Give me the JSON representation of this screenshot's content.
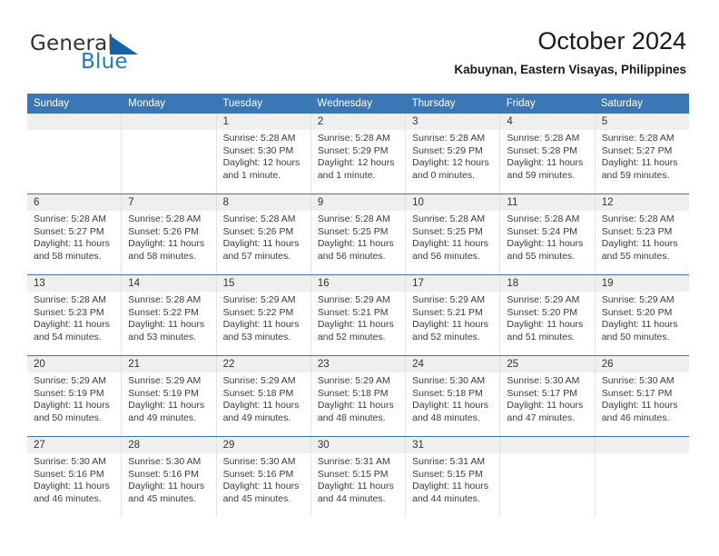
{
  "brand": {
    "name_part1": "General",
    "name_part2": "Blue",
    "mark_icon": "triangle-logo-icon"
  },
  "header": {
    "title": "October 2024",
    "subtitle": "Kabuynan, Eastern Visayas, Philippines"
  },
  "colors": {
    "header_blue": "#3a77b4",
    "brand_blue": "#1a7bc4",
    "date_band": "#efefef",
    "cell_border": "#e3e3e3",
    "text": "#3b3b3b"
  },
  "weekdays": [
    "Sunday",
    "Monday",
    "Tuesday",
    "Wednesday",
    "Thursday",
    "Friday",
    "Saturday"
  ],
  "weeks": [
    {
      "days": [
        {
          "num": "",
          "empty": true,
          "sunrise": "",
          "sunset": "",
          "daylight": ""
        },
        {
          "num": "",
          "empty": true,
          "sunrise": "",
          "sunset": "",
          "daylight": ""
        },
        {
          "num": "1",
          "sunrise": "Sunrise: 5:28 AM",
          "sunset": "Sunset: 5:30 PM",
          "daylight": "Daylight: 12 hours and 1 minute."
        },
        {
          "num": "2",
          "sunrise": "Sunrise: 5:28 AM",
          "sunset": "Sunset: 5:29 PM",
          "daylight": "Daylight: 12 hours and 1 minute."
        },
        {
          "num": "3",
          "sunrise": "Sunrise: 5:28 AM",
          "sunset": "Sunset: 5:29 PM",
          "daylight": "Daylight: 12 hours and 0 minutes."
        },
        {
          "num": "4",
          "sunrise": "Sunrise: 5:28 AM",
          "sunset": "Sunset: 5:28 PM",
          "daylight": "Daylight: 11 hours and 59 minutes."
        },
        {
          "num": "5",
          "sunrise": "Sunrise: 5:28 AM",
          "sunset": "Sunset: 5:27 PM",
          "daylight": "Daylight: 11 hours and 59 minutes."
        }
      ]
    },
    {
      "days": [
        {
          "num": "6",
          "sunrise": "Sunrise: 5:28 AM",
          "sunset": "Sunset: 5:27 PM",
          "daylight": "Daylight: 11 hours and 58 minutes."
        },
        {
          "num": "7",
          "sunrise": "Sunrise: 5:28 AM",
          "sunset": "Sunset: 5:26 PM",
          "daylight": "Daylight: 11 hours and 58 minutes."
        },
        {
          "num": "8",
          "sunrise": "Sunrise: 5:28 AM",
          "sunset": "Sunset: 5:26 PM",
          "daylight": "Daylight: 11 hours and 57 minutes."
        },
        {
          "num": "9",
          "sunrise": "Sunrise: 5:28 AM",
          "sunset": "Sunset: 5:25 PM",
          "daylight": "Daylight: 11 hours and 56 minutes."
        },
        {
          "num": "10",
          "sunrise": "Sunrise: 5:28 AM",
          "sunset": "Sunset: 5:25 PM",
          "daylight": "Daylight: 11 hours and 56 minutes."
        },
        {
          "num": "11",
          "sunrise": "Sunrise: 5:28 AM",
          "sunset": "Sunset: 5:24 PM",
          "daylight": "Daylight: 11 hours and 55 minutes."
        },
        {
          "num": "12",
          "sunrise": "Sunrise: 5:28 AM",
          "sunset": "Sunset: 5:23 PM",
          "daylight": "Daylight: 11 hours and 55 minutes."
        }
      ]
    },
    {
      "days": [
        {
          "num": "13",
          "sunrise": "Sunrise: 5:28 AM",
          "sunset": "Sunset: 5:23 PM",
          "daylight": "Daylight: 11 hours and 54 minutes."
        },
        {
          "num": "14",
          "sunrise": "Sunrise: 5:28 AM",
          "sunset": "Sunset: 5:22 PM",
          "daylight": "Daylight: 11 hours and 53 minutes."
        },
        {
          "num": "15",
          "sunrise": "Sunrise: 5:29 AM",
          "sunset": "Sunset: 5:22 PM",
          "daylight": "Daylight: 11 hours and 53 minutes."
        },
        {
          "num": "16",
          "sunrise": "Sunrise: 5:29 AM",
          "sunset": "Sunset: 5:21 PM",
          "daylight": "Daylight: 11 hours and 52 minutes."
        },
        {
          "num": "17",
          "sunrise": "Sunrise: 5:29 AM",
          "sunset": "Sunset: 5:21 PM",
          "daylight": "Daylight: 11 hours and 52 minutes."
        },
        {
          "num": "18",
          "sunrise": "Sunrise: 5:29 AM",
          "sunset": "Sunset: 5:20 PM",
          "daylight": "Daylight: 11 hours and 51 minutes."
        },
        {
          "num": "19",
          "sunrise": "Sunrise: 5:29 AM",
          "sunset": "Sunset: 5:20 PM",
          "daylight": "Daylight: 11 hours and 50 minutes."
        }
      ]
    },
    {
      "days": [
        {
          "num": "20",
          "sunrise": "Sunrise: 5:29 AM",
          "sunset": "Sunset: 5:19 PM",
          "daylight": "Daylight: 11 hours and 50 minutes."
        },
        {
          "num": "21",
          "sunrise": "Sunrise: 5:29 AM",
          "sunset": "Sunset: 5:19 PM",
          "daylight": "Daylight: 11 hours and 49 minutes."
        },
        {
          "num": "22",
          "sunrise": "Sunrise: 5:29 AM",
          "sunset": "Sunset: 5:18 PM",
          "daylight": "Daylight: 11 hours and 49 minutes."
        },
        {
          "num": "23",
          "sunrise": "Sunrise: 5:29 AM",
          "sunset": "Sunset: 5:18 PM",
          "daylight": "Daylight: 11 hours and 48 minutes."
        },
        {
          "num": "24",
          "sunrise": "Sunrise: 5:30 AM",
          "sunset": "Sunset: 5:18 PM",
          "daylight": "Daylight: 11 hours and 48 minutes."
        },
        {
          "num": "25",
          "sunrise": "Sunrise: 5:30 AM",
          "sunset": "Sunset: 5:17 PM",
          "daylight": "Daylight: 11 hours and 47 minutes."
        },
        {
          "num": "26",
          "sunrise": "Sunrise: 5:30 AM",
          "sunset": "Sunset: 5:17 PM",
          "daylight": "Daylight: 11 hours and 46 minutes."
        }
      ]
    },
    {
      "days": [
        {
          "num": "27",
          "sunrise": "Sunrise: 5:30 AM",
          "sunset": "Sunset: 5:16 PM",
          "daylight": "Daylight: 11 hours and 46 minutes."
        },
        {
          "num": "28",
          "sunrise": "Sunrise: 5:30 AM",
          "sunset": "Sunset: 5:16 PM",
          "daylight": "Daylight: 11 hours and 45 minutes."
        },
        {
          "num": "29",
          "sunrise": "Sunrise: 5:30 AM",
          "sunset": "Sunset: 5:16 PM",
          "daylight": "Daylight: 11 hours and 45 minutes."
        },
        {
          "num": "30",
          "sunrise": "Sunrise: 5:31 AM",
          "sunset": "Sunset: 5:15 PM",
          "daylight": "Daylight: 11 hours and 44 minutes."
        },
        {
          "num": "31",
          "sunrise": "Sunrise: 5:31 AM",
          "sunset": "Sunset: 5:15 PM",
          "daylight": "Daylight: 11 hours and 44 minutes."
        },
        {
          "num": "",
          "empty": true,
          "sunrise": "",
          "sunset": "",
          "daylight": ""
        },
        {
          "num": "",
          "empty": true,
          "sunrise": "",
          "sunset": "",
          "daylight": ""
        }
      ]
    }
  ]
}
